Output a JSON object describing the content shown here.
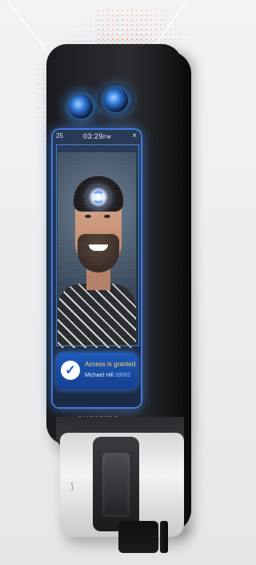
{
  "device": {
    "brand": "suprema",
    "screen": {
      "time": "03:29",
      "time_suffix": "PM",
      "left_glyph": "25",
      "close_glyph": "×"
    },
    "toast": {
      "title": "Access is granted",
      "name": "Michael Hill",
      "id": "39082",
      "check_glyph": "✓"
    },
    "icons": {
      "sync": "sync-icon",
      "rfid": "rfid-icon",
      "camera": "camera-icon",
      "fingerprint": "fingerprint-icon"
    },
    "colors": {
      "accent": "#2f7bff",
      "toast_bg": "#1e6ee6",
      "toast_title": "#ffd36a",
      "device_body": "#1e2024"
    }
  }
}
